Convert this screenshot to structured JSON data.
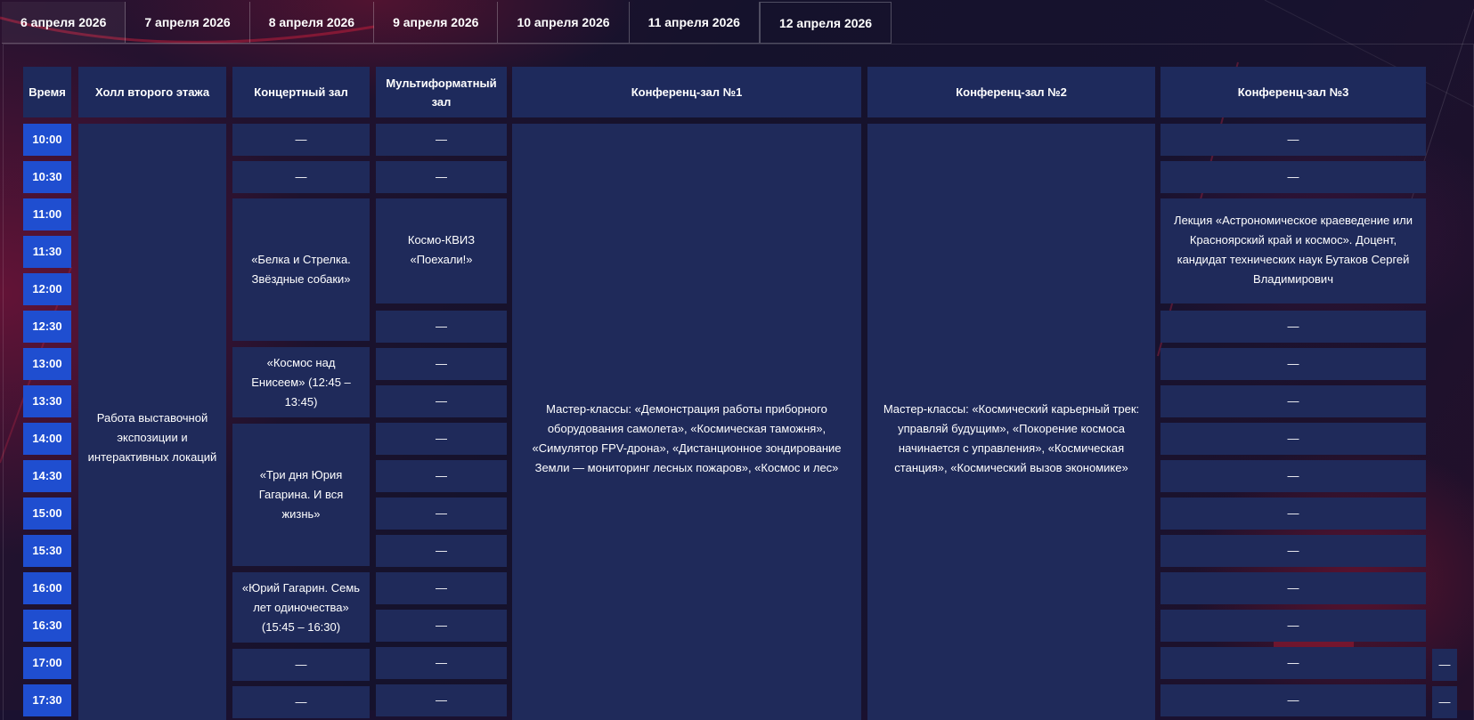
{
  "tabs": [
    {
      "label": "6 апреля 2026",
      "active": true
    },
    {
      "label": "7 апреля 2026",
      "active": false
    },
    {
      "label": "8 апреля 2026",
      "active": false
    },
    {
      "label": "9 апреля 2026",
      "active": false
    },
    {
      "label": "10 апреля 2026",
      "active": false
    },
    {
      "label": "11 апреля 2026",
      "active": false
    },
    {
      "label": "12 апреля 2026",
      "active": false
    }
  ],
  "headers": {
    "time": "Время",
    "hall": "Холл второго этажа",
    "concert": "Концертный зал",
    "multi": "Мультиформатный зал",
    "conf1": "Конференц-зал №1",
    "conf2": "Конференц-зал №2",
    "conf3": "Конференц-зал №3"
  },
  "times": [
    "10:00",
    "10:30",
    "11:00",
    "11:30",
    "12:00",
    "12:30",
    "13:00",
    "13:30",
    "14:00",
    "14:30",
    "15:00",
    "15:30",
    "16:00",
    "16:30",
    "17:00",
    "17:30"
  ],
  "dash": "—",
  "hall_event": "Работа выставочной экспозиции и интерактивных локаций",
  "concert": {
    "belka": "«Белка и Стрелка. Звёздные собаки»",
    "kosmos": "«Космос над Енисеем» (12:45 – 13:45)",
    "gagarin": "«Три дня Юрия Гагарина. И вся жизнь»",
    "seven": "«Юрий Гагарин. Семь лет одиночества» (15:45 – 16:30)"
  },
  "multi_quiz": "Космо-КВИЗ «Поехали!»",
  "conf1_event": "Мастер-классы: «Демонстрация работы приборного оборудования самолета», «Космическая таможня», «Симулятор FPV-дрона», «Дистанционное зондирование Земли — мониторинг лесных пожаров», «Космос и лес»",
  "conf2_event": "Мастер-классы: «Космический карьерный трек: управляй будущим», «Покорение космоса начинается с управления», «Космическая станция», «Космический вызов экономике»",
  "conf3_lecture": "Лекция «Астрономическое краеведение или Красноярский край и космос». Доцент, кандидат технических наук Бутаков Сергей Владимирович",
  "colors": {
    "cell": "#1f2a5a",
    "time_cell": "#1f4ed0",
    "background": "#1a1130"
  }
}
